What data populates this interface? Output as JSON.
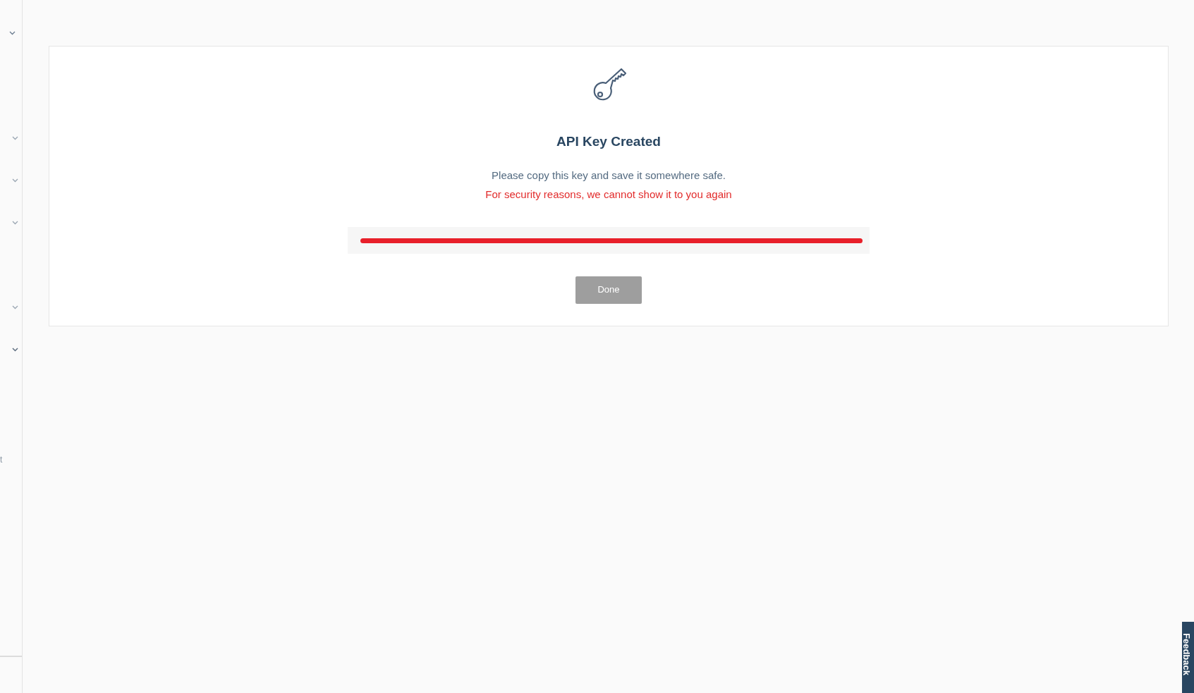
{
  "sidebar": {
    "fragment": "t"
  },
  "card": {
    "title": "API Key Created",
    "message": "Please copy this key and save it somewhere safe.",
    "warning": "For security reasons, we cannot show it to you again",
    "key_field": {
      "redacted": true
    },
    "button": "Done"
  },
  "feedback_tab": "Feedback"
}
